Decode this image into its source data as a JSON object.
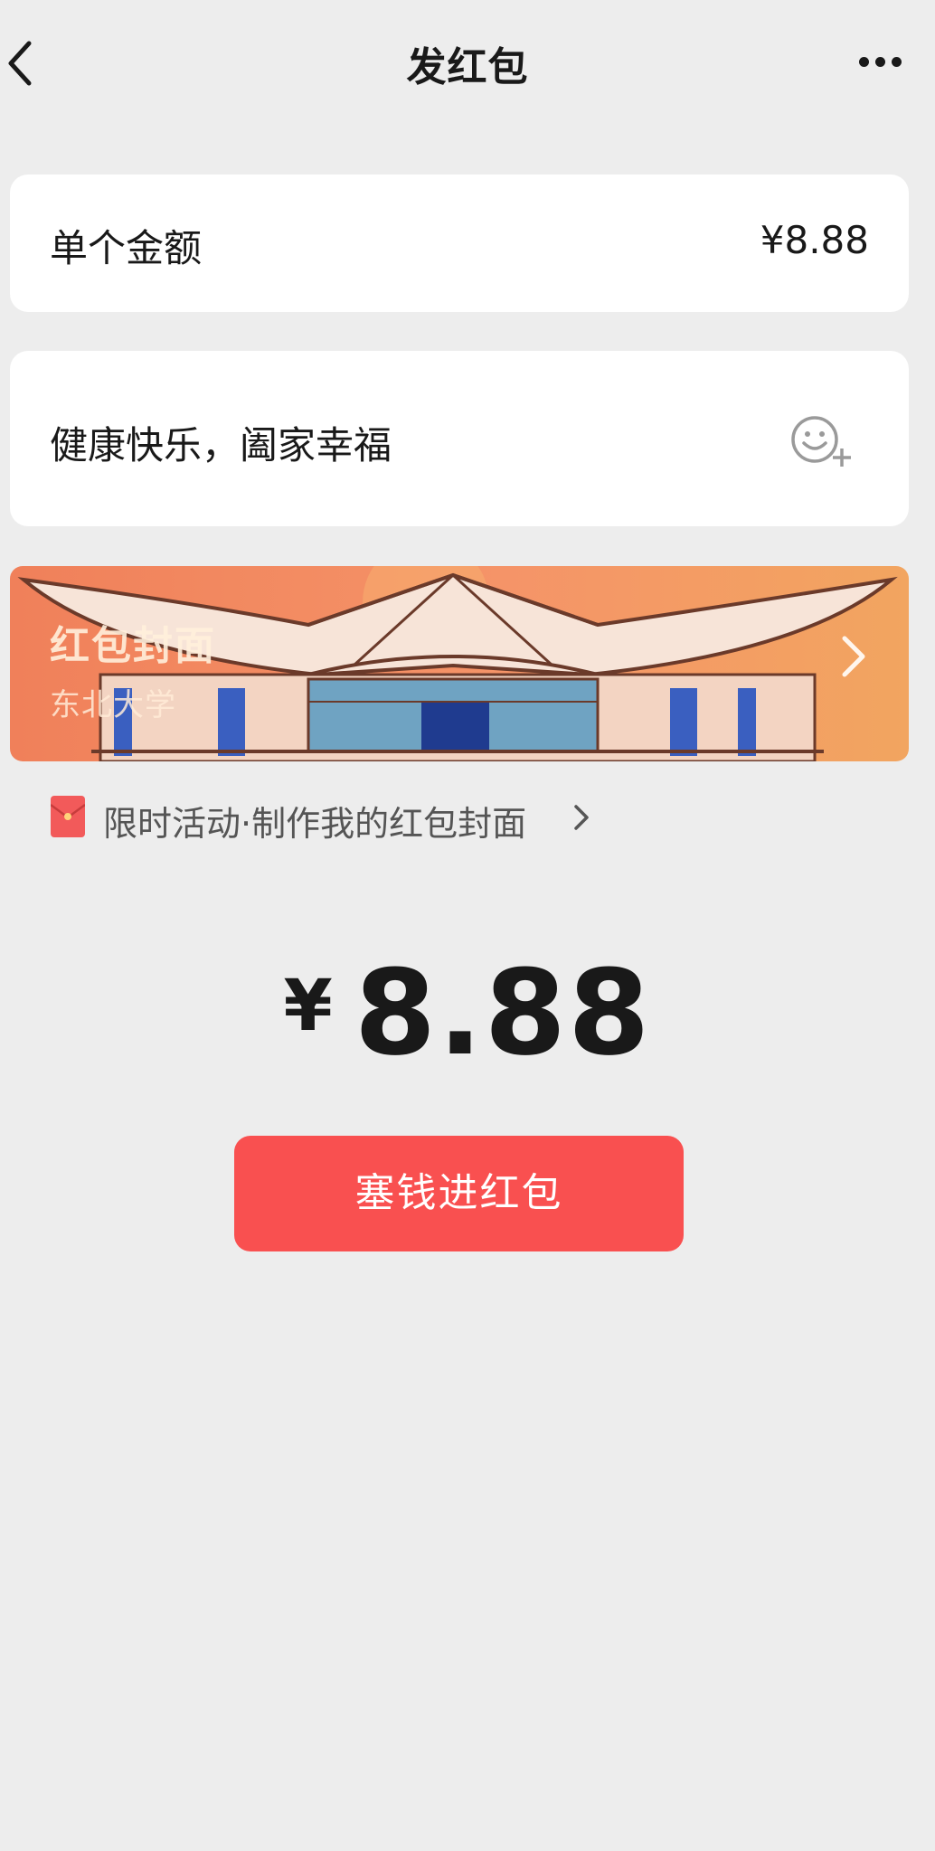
{
  "header": {
    "title": "发红包"
  },
  "amount": {
    "label": "单个金额",
    "value": "¥8.88"
  },
  "greeting": {
    "text": "健康快乐，阖家幸福"
  },
  "cover": {
    "title": "红包封面",
    "subtitle": "东北大学"
  },
  "promo": {
    "text": "限时活动·制作我的红包封面"
  },
  "total": {
    "symbol": "¥",
    "amount": "8.88"
  },
  "send_button": {
    "label": "塞钱进红包"
  },
  "colors": {
    "accent": "#f95050",
    "background": "#ededed",
    "card": "#ffffff",
    "banner": "#f59468"
  },
  "icons": [
    "back-arrow-icon",
    "more-icon",
    "emoji-add-icon",
    "chevron-right-icon",
    "red-envelope-icon"
  ]
}
